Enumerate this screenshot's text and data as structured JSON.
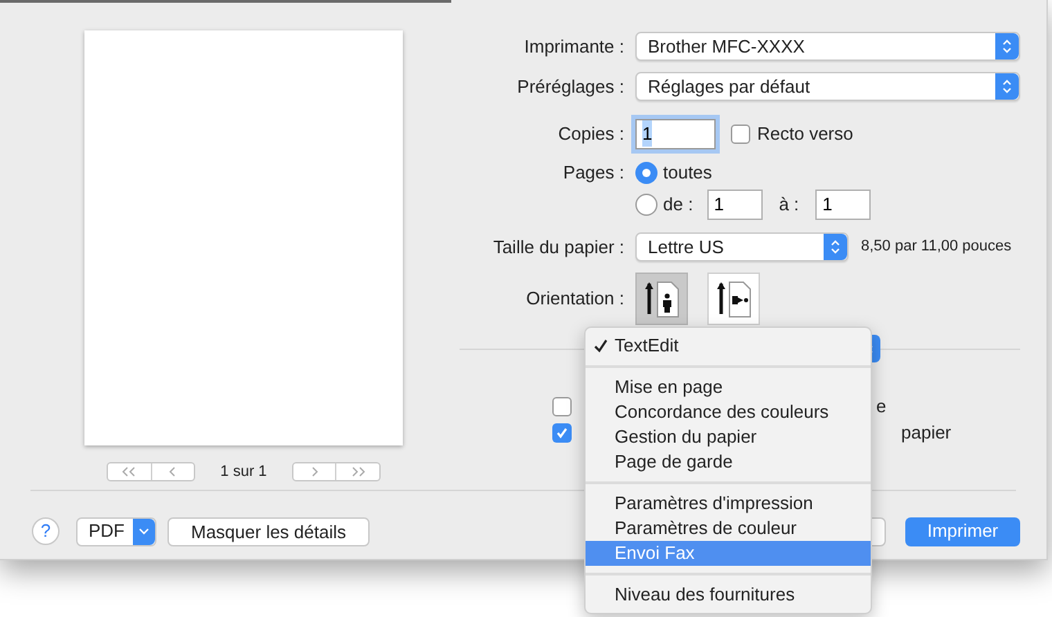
{
  "preview": {
    "page_count": "1 sur 1"
  },
  "printer": {
    "label": "Imprimante :",
    "value": "Brother MFC-XXXX"
  },
  "presets": {
    "label": "Préréglages :",
    "value": "Réglages par défaut"
  },
  "copies": {
    "label": "Copies :",
    "value": "1",
    "duplex": {
      "label": "Recto verso",
      "checked": false
    }
  },
  "pages": {
    "label": "Pages :",
    "options": [
      {
        "label": "toutes",
        "selected": true
      },
      {
        "label": "de :",
        "selected": false
      }
    ],
    "from": "1",
    "to_label": "à :",
    "to": "1"
  },
  "paper_size": {
    "label": "Taille du papier :",
    "value": "Lettre US",
    "dimensions": "8,50 par 11,00 pouces"
  },
  "orientation": {
    "label": "Orientation :",
    "options": [
      {
        "kind": "portrait",
        "selected": true
      },
      {
        "kind": "landscape",
        "selected": false
      }
    ]
  },
  "options": [
    {
      "text": "e",
      "checked": false
    },
    {
      "text": "papier",
      "checked": true
    }
  ],
  "footer": {
    "help": "?",
    "pdf": "PDF",
    "details": "Masquer les détails",
    "print": "Imprimer"
  },
  "menu": {
    "groups": [
      [
        {
          "label": "TextEdit",
          "checked": true,
          "selected": false
        }
      ],
      [
        {
          "label": "Mise en page",
          "checked": false,
          "selected": false
        },
        {
          "label": "Concordance des couleurs",
          "checked": false,
          "selected": false
        },
        {
          "label": "Gestion du papier",
          "checked": false,
          "selected": false
        },
        {
          "label": "Page de garde",
          "checked": false,
          "selected": false
        }
      ],
      [
        {
          "label": "Paramètres d'impression",
          "checked": false,
          "selected": false
        },
        {
          "label": "Paramètres de couleur",
          "checked": false,
          "selected": false
        },
        {
          "label": "Envoi Fax",
          "checked": false,
          "selected": true
        }
      ],
      [
        {
          "label": "Niveau des fournitures",
          "checked": false,
          "selected": false
        }
      ]
    ]
  }
}
